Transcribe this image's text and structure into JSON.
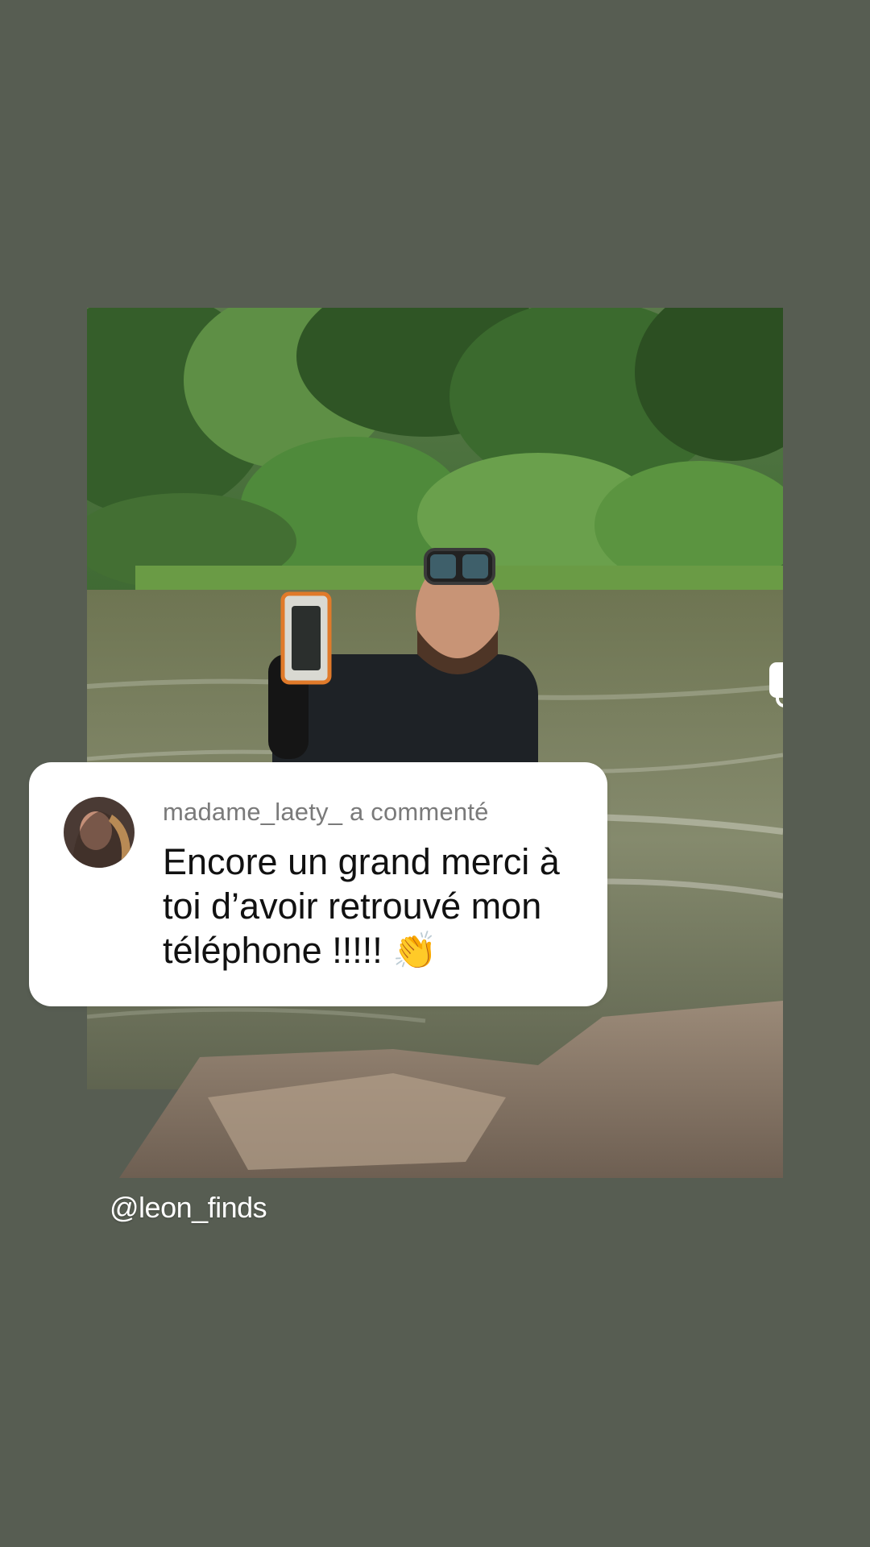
{
  "comment": {
    "username": "madame_laety_",
    "action": "a commenté",
    "text": "Encore un grand merci à toi d’avoir retrouvé mon téléphone !!!!! 👏"
  },
  "post": {
    "handle": "@leon_finds",
    "multi_image_icon": "carousel-icon"
  },
  "colors": {
    "background": "#575d52",
    "card": "#ffffff",
    "header_text": "#7a7a7a",
    "body_text": "#111111"
  }
}
